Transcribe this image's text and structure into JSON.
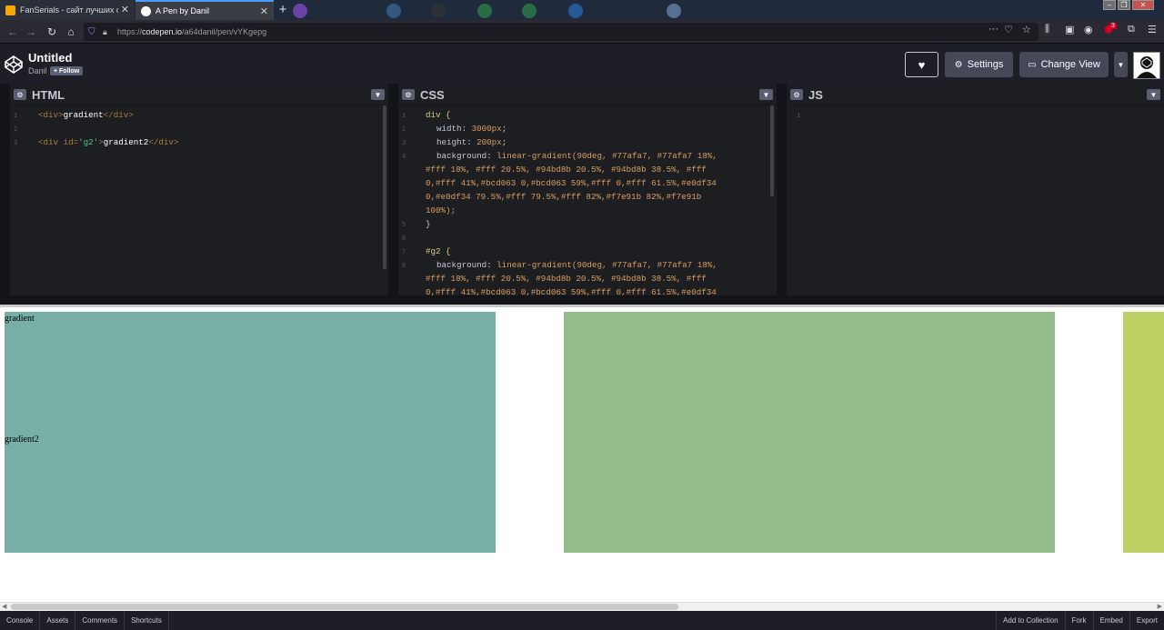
{
  "browser": {
    "tabs": [
      {
        "title": "FanSerials - сайт лучших сери",
        "favicon_color": "#f6a800",
        "active": false
      },
      {
        "title": "A Pen by Danil",
        "favicon_color": "#ffffff",
        "active": true
      }
    ],
    "url_prefix": "https://",
    "url_domain": "codepen.io",
    "url_path": "/a64danil/pen/vYKgepg",
    "extension_badge": "3"
  },
  "header": {
    "title": "Untitled",
    "author": "Danil",
    "follow_label": "+ Follow",
    "settings_label": "Settings",
    "change_view_label": "Change View"
  },
  "panes": {
    "html": {
      "title": "HTML",
      "line_numbers": [
        "1",
        "2",
        "3"
      ],
      "lines": [
        {
          "open": "<div>",
          "text": "gradient",
          "close": "</div>"
        },
        {
          "open": "<div ",
          "attr": "id=",
          "value": "'g2'",
          "gt": ">",
          "text": "gradient2",
          "close": "</div>"
        }
      ]
    },
    "css": {
      "title": "CSS",
      "line_numbers": [
        "1",
        "2",
        "3",
        "4",
        "5",
        "6",
        "7",
        "8"
      ],
      "line1": "div {",
      "width_prop": "width:",
      "width_val": "3000px",
      "height_prop": "height:",
      "height_val": "200px",
      "bg_prop": "background:",
      "bg_fn": "linear-gradient",
      "bg_lines": [
        "(90deg, #77afa7, #77afa7 18%,",
        "#fff 18%, #fff 20.5%, #94bd8b 20.5%, #94bd8b 38.5%, #fff",
        "0,#fff 41%,#bcd063 0,#bcd063 59%,#fff 0,#fff 61.5%,#e0df34",
        "0,#e0df34 79.5%,#fff 79.5%,#fff 82%,#f7e91b 82%,#f7e91b",
        "100%);"
      ],
      "close": "}",
      "sel2": "#g2 {",
      "bg2_lines": [
        "(90deg, #77afa7, #77afa7 18%,",
        "#fff 18%, #fff 20.5%, #94bd8b 20.5%, #94bd8b 38.5%, #fff",
        "0,#fff 41%,#bcd063 0,#bcd063 59%,#fff 0,#fff 61.5%,#e0df34"
      ]
    },
    "js": {
      "title": "JS",
      "line_numbers": [
        "1"
      ]
    }
  },
  "preview": {
    "label1": "gradient",
    "label2": "gradient2",
    "gradient": "linear-gradient(90deg, #77afa7, #77afa7 18%, #fff 18%, #fff 20.5%, #94bd8b 20.5%, #94bd8b 38.5%, #fff 0, #fff 41%, #bcd063 0, #bcd063 59%, #fff 0, #fff 61.5%, #e0df34 0, #e0df34 79.5%, #fff 79.5%, #fff 82%, #f7e91b 82%, #f7e91b 100%)"
  },
  "footer": {
    "left": [
      "Console",
      "Assets",
      "Comments",
      "Shortcuts"
    ],
    "right": [
      "Add to Collection",
      "Fork",
      "Embed",
      "Export"
    ]
  }
}
